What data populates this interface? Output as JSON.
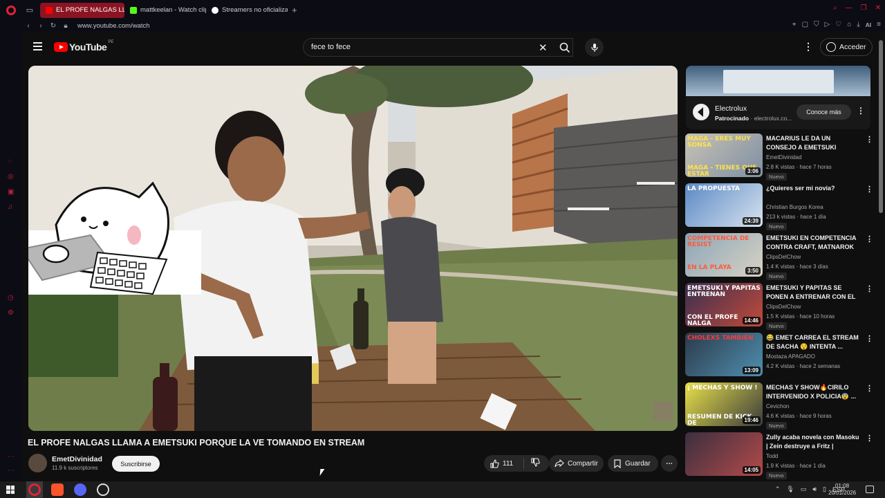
{
  "browser": {
    "tabs": [
      {
        "label": "EL PROFE NALGAS LL",
        "icon": "youtube-icon",
        "active": true
      },
      {
        "label": "mattkeelan - Watch clips",
        "icon": "kick-icon",
        "active": false
      },
      {
        "label": "Streamers no oficializan #",
        "icon": "tiktok-icon",
        "active": false
      }
    ],
    "url": "www.youtube.com/watch",
    "toolbar_ai_label": "AI",
    "accent": "#e0223b"
  },
  "youtube": {
    "logo_text": "YouTube",
    "country_code": "PE",
    "search_value": "fece to fece",
    "signin_label": "Acceder"
  },
  "video": {
    "title": "EL PROFE NALGAS LLAMA A EMETSUKI PORQUE LA VE TOMANDO EN STREAM",
    "channel": "EmetDivinidad",
    "subscribers": "11.9 k suscriptores",
    "subscribe_label": "Suscribirse",
    "likes": "111",
    "share_label": "Compartir",
    "save_label": "Guardar"
  },
  "ad": {
    "brand": "Electrolux",
    "sponsored": "Patrocinado",
    "domain": "electrolux.co...",
    "separator": " · ",
    "cta": "Conoce más"
  },
  "recommendations": [
    {
      "title": "MACARIUS LE DA UN CONSEJO A EMETSUKI",
      "channel": "EmetDivinidad",
      "meta": "2.8 K vistas · hace 7 horas",
      "badge": "Nuevo",
      "duration": "3:06",
      "thumb_text": "MAGA - ERES MUY SONSA",
      "thumb_text2": "MAGA - TIENES QUE ESTAR"
    },
    {
      "title": "¿Quieres ser mi novia?",
      "channel": "Christian Burgos Korea",
      "meta": "213 k vistas · hace 1 día",
      "badge": "Nuevo",
      "duration": "24:39",
      "thumb_text": "LA PROPUESTA",
      "thumb_text2": ""
    },
    {
      "title": "EMETSUKI EN COMPETENCIA CONTRA CRAFT, MATNAROK ...",
      "channel": "ClipsDelChow",
      "meta": "1.4 K vistas · hace 3 días",
      "badge": "Nuevo",
      "duration": "3:50",
      "thumb_text": "COMPETENCIA DE RESIST",
      "thumb_text2": "EN LA PLAYA"
    },
    {
      "title": "EMETSUKI Y PAPITAS SE PONEN A ENTRENAR CON EL ...",
      "channel": "ClipsDelChow",
      "meta": "1.5 K vistas · hace 10 horas",
      "badge": "Nuevo",
      "duration": "14:46",
      "thumb_text": "EMETSUKI Y PAPITAS ENTRENAN",
      "thumb_text2": "CON EL PROFE NALGA"
    },
    {
      "title": "😂 EMET CARREA EL STREAM DE SACHA 😯 INTENTA ...",
      "channel": "Mostaza APAGADO",
      "meta": "4.2 K vistas · hace 2 semanas",
      "badge": "",
      "duration": "13:09",
      "thumb_text": "CHOLEXS TAMBIEN",
      "thumb_text2": ""
    },
    {
      "title": "MECHAS Y SHOW🔥CIRILO INTERVENIDO X POLICIA😨 ...",
      "channel": "Cevichon",
      "meta": "4.6 K vistas · hace 9 horas",
      "badge": "Nuevo",
      "duration": "19:46",
      "thumb_text": "¡ MECHAS Y SHOW !",
      "thumb_text2": "RESUMEN DE KICK DE"
    },
    {
      "title": "Zully acaba novela con Masoku | Zein destruye a Fritz | Jefrain...",
      "channel": "Todd",
      "meta": "1.9 K vistas · hace 1 día",
      "badge": "Nuevo",
      "duration": "14:05",
      "thumb_text": "",
      "thumb_text2": ""
    }
  ],
  "taskbar": {
    "language": "ESP",
    "time": "01:08",
    "date": "20/01/2026"
  }
}
